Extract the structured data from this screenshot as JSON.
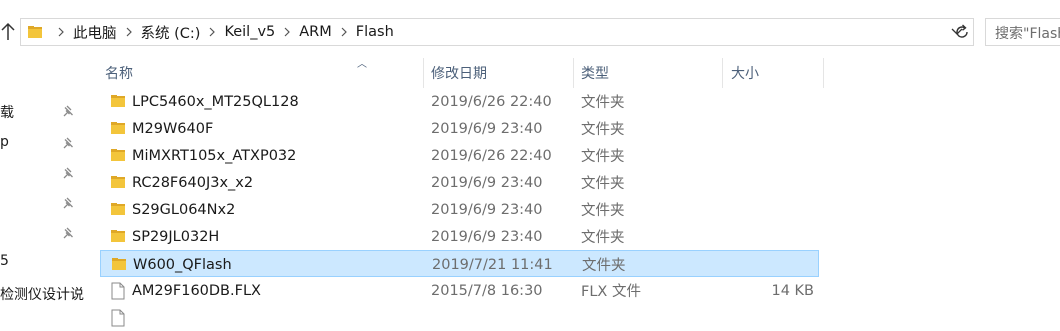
{
  "breadcrumbs": [
    "此电脑",
    "系统 (C:)",
    "Keil_v5",
    "ARM",
    "Flash"
  ],
  "search": {
    "placeholder": "搜索\"Flash\""
  },
  "nav_pane": [
    {
      "label": "载",
      "pinned": true
    },
    {
      "label": "p",
      "pinned": true
    },
    {
      "label": "",
      "pinned": true
    },
    {
      "label": "",
      "pinned": true
    },
    {
      "label": "",
      "pinned": true
    },
    {
      "label": "5",
      "pinned": false
    },
    {
      "label": "检测仪设计说",
      "pinned": false
    }
  ],
  "columns": {
    "name": "名称",
    "date": "修改日期",
    "type": "类型",
    "size": "大小"
  },
  "files": [
    {
      "name": "LPC5460x_MT25QL128",
      "date": "2019/6/26 22:40",
      "type": "文件夹",
      "size": "",
      "kind": "folder",
      "selected": false
    },
    {
      "name": "M29W640F",
      "date": "2019/6/9 23:40",
      "type": "文件夹",
      "size": "",
      "kind": "folder",
      "selected": false
    },
    {
      "name": "MiMXRT105x_ATXP032",
      "date": "2019/6/26 22:40",
      "type": "文件夹",
      "size": "",
      "kind": "folder",
      "selected": false
    },
    {
      "name": "RC28F640J3x_x2",
      "date": "2019/6/9 23:40",
      "type": "文件夹",
      "size": "",
      "kind": "folder",
      "selected": false
    },
    {
      "name": "S29GL064Nx2",
      "date": "2019/6/9 23:40",
      "type": "文件夹",
      "size": "",
      "kind": "folder",
      "selected": false
    },
    {
      "name": "SP29JL032H",
      "date": "2019/6/9 23:40",
      "type": "文件夹",
      "size": "",
      "kind": "folder",
      "selected": false
    },
    {
      "name": "W600_QFlash",
      "date": "2019/7/21 11:41",
      "type": "文件夹",
      "size": "",
      "kind": "folder",
      "selected": true
    },
    {
      "name": "AM29F160DB.FLX",
      "date": "2015/7/8 16:30",
      "type": "FLX 文件",
      "size": "14 KB",
      "kind": "file",
      "selected": false
    },
    {
      "name": "",
      "date": "",
      "type": "",
      "size": "",
      "kind": "file",
      "selected": false
    }
  ],
  "colors": {
    "folder": "#f3c53b",
    "folder_dark": "#dfa827",
    "selected_bg": "#cce8ff",
    "selected_border": "#99d1ff",
    "header_text": "#4c607a"
  }
}
